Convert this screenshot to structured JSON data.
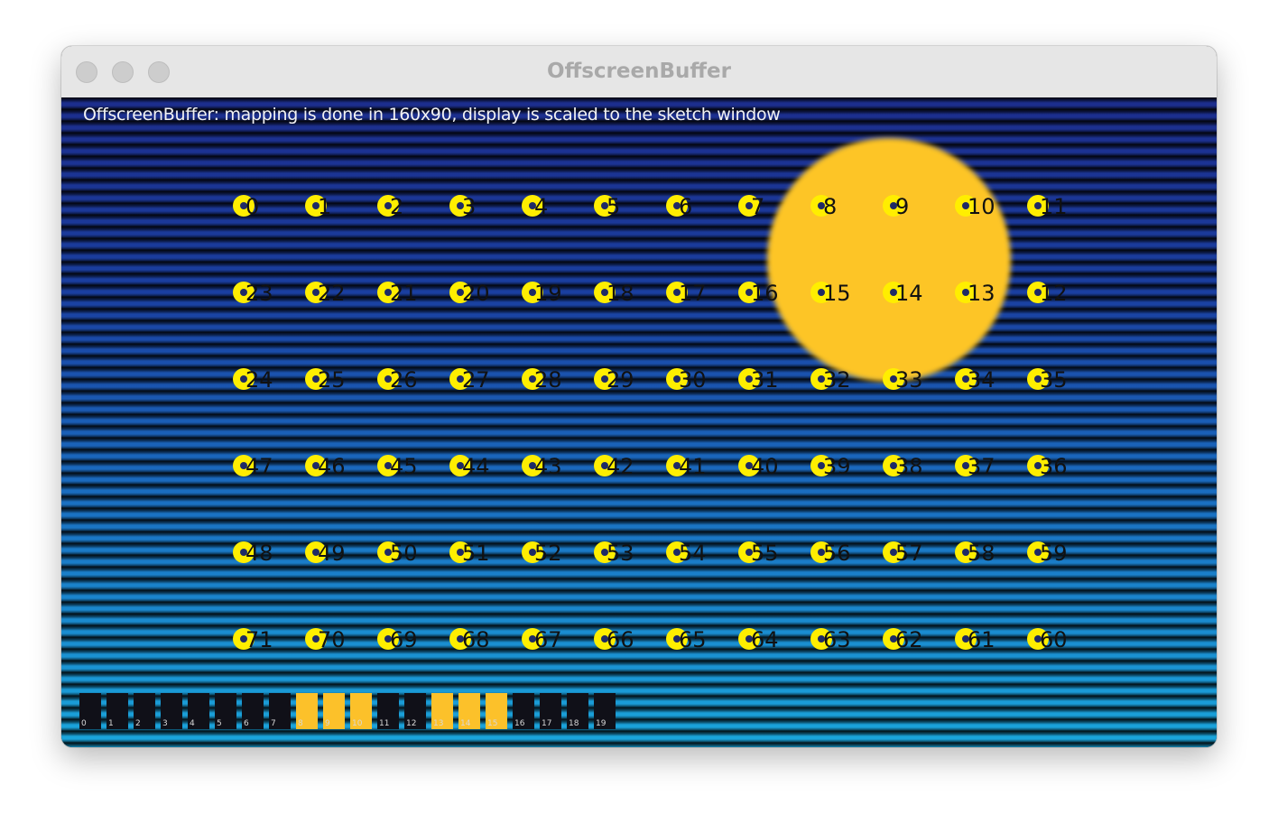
{
  "window": {
    "title": "OffscreenBuffer"
  },
  "canvas": {
    "caption": "OffscreenBuffer: mapping is done in 160x90, display is scaled to the sketch window",
    "sun_color": "#fdc526",
    "led_color": "#ffee00",
    "led_rows": [
      [
        "0",
        "1",
        "2",
        "3",
        "4",
        "5",
        "6",
        "7",
        "8",
        "9",
        "10",
        "11"
      ],
      [
        "23",
        "22",
        "21",
        "20",
        "19",
        "18",
        "17",
        "16",
        "15",
        "14",
        "13",
        "12"
      ],
      [
        "24",
        "25",
        "26",
        "27",
        "28",
        "29",
        "30",
        "31",
        "32",
        "33",
        "34",
        "35"
      ],
      [
        "47",
        "46",
        "45",
        "44",
        "43",
        "42",
        "41",
        "40",
        "39",
        "38",
        "37",
        "36"
      ],
      [
        "48",
        "49",
        "50",
        "51",
        "52",
        "53",
        "54",
        "55",
        "56",
        "57",
        "58",
        "59"
      ],
      [
        "71",
        "70",
        "69",
        "68",
        "67",
        "66",
        "65",
        "64",
        "63",
        "62",
        "61",
        "60"
      ]
    ],
    "channels": [
      {
        "label": "0",
        "on": false
      },
      {
        "label": "1",
        "on": false
      },
      {
        "label": "2",
        "on": false
      },
      {
        "label": "3",
        "on": false
      },
      {
        "label": "4",
        "on": false
      },
      {
        "label": "5",
        "on": false
      },
      {
        "label": "6",
        "on": false
      },
      {
        "label": "7",
        "on": false
      },
      {
        "label": "8",
        "on": true
      },
      {
        "label": "9",
        "on": true
      },
      {
        "label": "10",
        "on": true
      },
      {
        "label": "11",
        "on": false
      },
      {
        "label": "12",
        "on": false
      },
      {
        "label": "13",
        "on": true
      },
      {
        "label": "14",
        "on": true
      },
      {
        "label": "15",
        "on": true
      },
      {
        "label": "16",
        "on": false
      },
      {
        "label": "17",
        "on": false
      },
      {
        "label": "18",
        "on": false
      },
      {
        "label": "19",
        "on": false
      }
    ]
  }
}
